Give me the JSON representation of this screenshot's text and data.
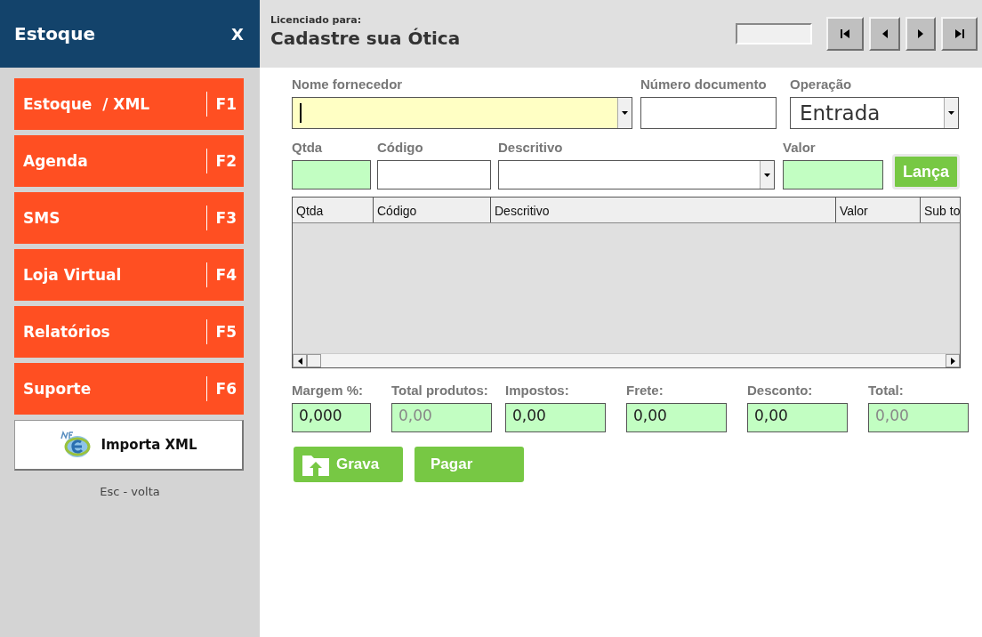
{
  "sidebar": {
    "title": "Estoque",
    "close": "X",
    "menu": [
      {
        "label": "Estoque  / XML",
        "key": "F1"
      },
      {
        "label": "Agenda",
        "key": "F2"
      },
      {
        "label": "SMS",
        "key": "F3"
      },
      {
        "label": "Loja Virtual",
        "key": "F4"
      },
      {
        "label": "Relatórios",
        "key": "F5"
      },
      {
        "label": "Suporte",
        "key": "F6"
      }
    ],
    "import_button": "Importa XML",
    "hint": "Esc - volta"
  },
  "header": {
    "licensed_label": "Licenciado para:",
    "company": "Cadastre sua Ótica"
  },
  "form": {
    "row1": [
      {
        "kind": "combo",
        "label": "Nome fornecedor",
        "focused": true,
        "color": "#ffffc4"
      },
      {
        "kind": "text",
        "label": "Número documento",
        "focused": false,
        "color": "#ffffff"
      },
      {
        "kind": "combo",
        "label": "Operação",
        "value": "Entrada",
        "focused": false,
        "color": "#ffffff"
      }
    ],
    "row2": [
      {
        "kind": "text",
        "label": "Qtda",
        "focused": false,
        "color": "#c2fec2"
      },
      {
        "kind": "text",
        "label": "Código",
        "focused": false,
        "color": "#ffffff"
      },
      {
        "kind": "combo",
        "label": "Descritivo",
        "focused": false,
        "color": "#ffffff"
      },
      {
        "kind": "text",
        "label": "Valor",
        "focused": false,
        "color": "#c2fec2"
      }
    ],
    "add_button": "Lança"
  },
  "table": {
    "columns": [
      "Qtda",
      "Código",
      "Descritivo",
      "Valor",
      "Sub to"
    ]
  },
  "totals": [
    {
      "label": "Margem %:",
      "value": "0,000",
      "disabled": false
    },
    {
      "label": "Total produtos:",
      "value": "0,00",
      "disabled": true
    },
    {
      "label": "Impostos:",
      "value": "0,00",
      "disabled": false
    },
    {
      "label": "Frete:",
      "value": "0,00",
      "disabled": false
    },
    {
      "label": "Desconto:",
      "value": "0,00",
      "disabled": false
    },
    {
      "label": "Total:",
      "value": "0,00",
      "disabled": true
    }
  ],
  "actions": [
    "Grava",
    "Pagar"
  ]
}
